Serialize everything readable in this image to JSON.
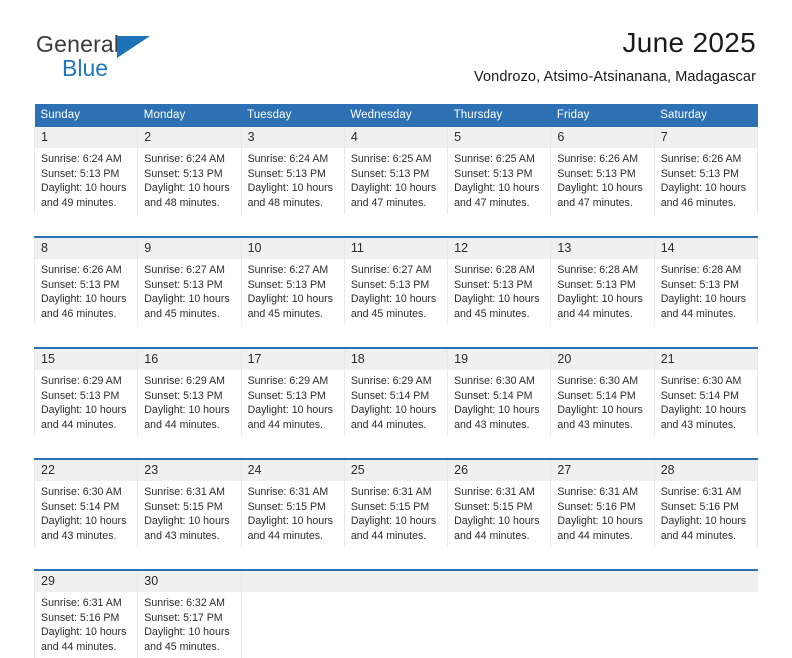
{
  "brand": {
    "name_top": "General",
    "name_bottom": "Blue",
    "triangle_color": "#1e72b8",
    "blue_color": "#1f77c1"
  },
  "header": {
    "title": "June 2025",
    "subtitle": "Vondrozo, Atsimo-Atsinanana, Madagascar"
  },
  "theme": {
    "header_bg": "#2d71b4",
    "header_text": "#ffffff",
    "daynum_bg": "#f0f0f0",
    "rule_color": "#2d71b4"
  },
  "calendar": {
    "weekday_headers": [
      "Sunday",
      "Monday",
      "Tuesday",
      "Wednesday",
      "Thursday",
      "Friday",
      "Saturday"
    ],
    "weeks": [
      [
        {
          "day": "1",
          "sunrise": "Sunrise: 6:24 AM",
          "sunset": "Sunset: 5:13 PM",
          "daylight_line1": "Daylight: 10 hours",
          "daylight_line2": "and 49 minutes."
        },
        {
          "day": "2",
          "sunrise": "Sunrise: 6:24 AM",
          "sunset": "Sunset: 5:13 PM",
          "daylight_line1": "Daylight: 10 hours",
          "daylight_line2": "and 48 minutes."
        },
        {
          "day": "3",
          "sunrise": "Sunrise: 6:24 AM",
          "sunset": "Sunset: 5:13 PM",
          "daylight_line1": "Daylight: 10 hours",
          "daylight_line2": "and 48 minutes."
        },
        {
          "day": "4",
          "sunrise": "Sunrise: 6:25 AM",
          "sunset": "Sunset: 5:13 PM",
          "daylight_line1": "Daylight: 10 hours",
          "daylight_line2": "and 47 minutes."
        },
        {
          "day": "5",
          "sunrise": "Sunrise: 6:25 AM",
          "sunset": "Sunset: 5:13 PM",
          "daylight_line1": "Daylight: 10 hours",
          "daylight_line2": "and 47 minutes."
        },
        {
          "day": "6",
          "sunrise": "Sunrise: 6:26 AM",
          "sunset": "Sunset: 5:13 PM",
          "daylight_line1": "Daylight: 10 hours",
          "daylight_line2": "and 47 minutes."
        },
        {
          "day": "7",
          "sunrise": "Sunrise: 6:26 AM",
          "sunset": "Sunset: 5:13 PM",
          "daylight_line1": "Daylight: 10 hours",
          "daylight_line2": "and 46 minutes."
        }
      ],
      [
        {
          "day": "8",
          "sunrise": "Sunrise: 6:26 AM",
          "sunset": "Sunset: 5:13 PM",
          "daylight_line1": "Daylight: 10 hours",
          "daylight_line2": "and 46 minutes."
        },
        {
          "day": "9",
          "sunrise": "Sunrise: 6:27 AM",
          "sunset": "Sunset: 5:13 PM",
          "daylight_line1": "Daylight: 10 hours",
          "daylight_line2": "and 45 minutes."
        },
        {
          "day": "10",
          "sunrise": "Sunrise: 6:27 AM",
          "sunset": "Sunset: 5:13 PM",
          "daylight_line1": "Daylight: 10 hours",
          "daylight_line2": "and 45 minutes."
        },
        {
          "day": "11",
          "sunrise": "Sunrise: 6:27 AM",
          "sunset": "Sunset: 5:13 PM",
          "daylight_line1": "Daylight: 10 hours",
          "daylight_line2": "and 45 minutes."
        },
        {
          "day": "12",
          "sunrise": "Sunrise: 6:28 AM",
          "sunset": "Sunset: 5:13 PM",
          "daylight_line1": "Daylight: 10 hours",
          "daylight_line2": "and 45 minutes."
        },
        {
          "day": "13",
          "sunrise": "Sunrise: 6:28 AM",
          "sunset": "Sunset: 5:13 PM",
          "daylight_line1": "Daylight: 10 hours",
          "daylight_line2": "and 44 minutes."
        },
        {
          "day": "14",
          "sunrise": "Sunrise: 6:28 AM",
          "sunset": "Sunset: 5:13 PM",
          "daylight_line1": "Daylight: 10 hours",
          "daylight_line2": "and 44 minutes."
        }
      ],
      [
        {
          "day": "15",
          "sunrise": "Sunrise: 6:29 AM",
          "sunset": "Sunset: 5:13 PM",
          "daylight_line1": "Daylight: 10 hours",
          "daylight_line2": "and 44 minutes."
        },
        {
          "day": "16",
          "sunrise": "Sunrise: 6:29 AM",
          "sunset": "Sunset: 5:13 PM",
          "daylight_line1": "Daylight: 10 hours",
          "daylight_line2": "and 44 minutes."
        },
        {
          "day": "17",
          "sunrise": "Sunrise: 6:29 AM",
          "sunset": "Sunset: 5:13 PM",
          "daylight_line1": "Daylight: 10 hours",
          "daylight_line2": "and 44 minutes."
        },
        {
          "day": "18",
          "sunrise": "Sunrise: 6:29 AM",
          "sunset": "Sunset: 5:14 PM",
          "daylight_line1": "Daylight: 10 hours",
          "daylight_line2": "and 44 minutes."
        },
        {
          "day": "19",
          "sunrise": "Sunrise: 6:30 AM",
          "sunset": "Sunset: 5:14 PM",
          "daylight_line1": "Daylight: 10 hours",
          "daylight_line2": "and 43 minutes."
        },
        {
          "day": "20",
          "sunrise": "Sunrise: 6:30 AM",
          "sunset": "Sunset: 5:14 PM",
          "daylight_line1": "Daylight: 10 hours",
          "daylight_line2": "and 43 minutes."
        },
        {
          "day": "21",
          "sunrise": "Sunrise: 6:30 AM",
          "sunset": "Sunset: 5:14 PM",
          "daylight_line1": "Daylight: 10 hours",
          "daylight_line2": "and 43 minutes."
        }
      ],
      [
        {
          "day": "22",
          "sunrise": "Sunrise: 6:30 AM",
          "sunset": "Sunset: 5:14 PM",
          "daylight_line1": "Daylight: 10 hours",
          "daylight_line2": "and 43 minutes."
        },
        {
          "day": "23",
          "sunrise": "Sunrise: 6:31 AM",
          "sunset": "Sunset: 5:15 PM",
          "daylight_line1": "Daylight: 10 hours",
          "daylight_line2": "and 43 minutes."
        },
        {
          "day": "24",
          "sunrise": "Sunrise: 6:31 AM",
          "sunset": "Sunset: 5:15 PM",
          "daylight_line1": "Daylight: 10 hours",
          "daylight_line2": "and 44 minutes."
        },
        {
          "day": "25",
          "sunrise": "Sunrise: 6:31 AM",
          "sunset": "Sunset: 5:15 PM",
          "daylight_line1": "Daylight: 10 hours",
          "daylight_line2": "and 44 minutes."
        },
        {
          "day": "26",
          "sunrise": "Sunrise: 6:31 AM",
          "sunset": "Sunset: 5:15 PM",
          "daylight_line1": "Daylight: 10 hours",
          "daylight_line2": "and 44 minutes."
        },
        {
          "day": "27",
          "sunrise": "Sunrise: 6:31 AM",
          "sunset": "Sunset: 5:16 PM",
          "daylight_line1": "Daylight: 10 hours",
          "daylight_line2": "and 44 minutes."
        },
        {
          "day": "28",
          "sunrise": "Sunrise: 6:31 AM",
          "sunset": "Sunset: 5:16 PM",
          "daylight_line1": "Daylight: 10 hours",
          "daylight_line2": "and 44 minutes."
        }
      ],
      [
        {
          "day": "29",
          "sunrise": "Sunrise: 6:31 AM",
          "sunset": "Sunset: 5:16 PM",
          "daylight_line1": "Daylight: 10 hours",
          "daylight_line2": "and 44 minutes."
        },
        {
          "day": "30",
          "sunrise": "Sunrise: 6:32 AM",
          "sunset": "Sunset: 5:17 PM",
          "daylight_line1": "Daylight: 10 hours",
          "daylight_line2": "and 45 minutes."
        },
        {
          "day": "",
          "sunrise": "",
          "sunset": "",
          "daylight_line1": "",
          "daylight_line2": ""
        },
        {
          "day": "",
          "sunrise": "",
          "sunset": "",
          "daylight_line1": "",
          "daylight_line2": ""
        },
        {
          "day": "",
          "sunrise": "",
          "sunset": "",
          "daylight_line1": "",
          "daylight_line2": ""
        },
        {
          "day": "",
          "sunrise": "",
          "sunset": "",
          "daylight_line1": "",
          "daylight_line2": ""
        },
        {
          "day": "",
          "sunrise": "",
          "sunset": "",
          "daylight_line1": "",
          "daylight_line2": ""
        }
      ]
    ]
  }
}
